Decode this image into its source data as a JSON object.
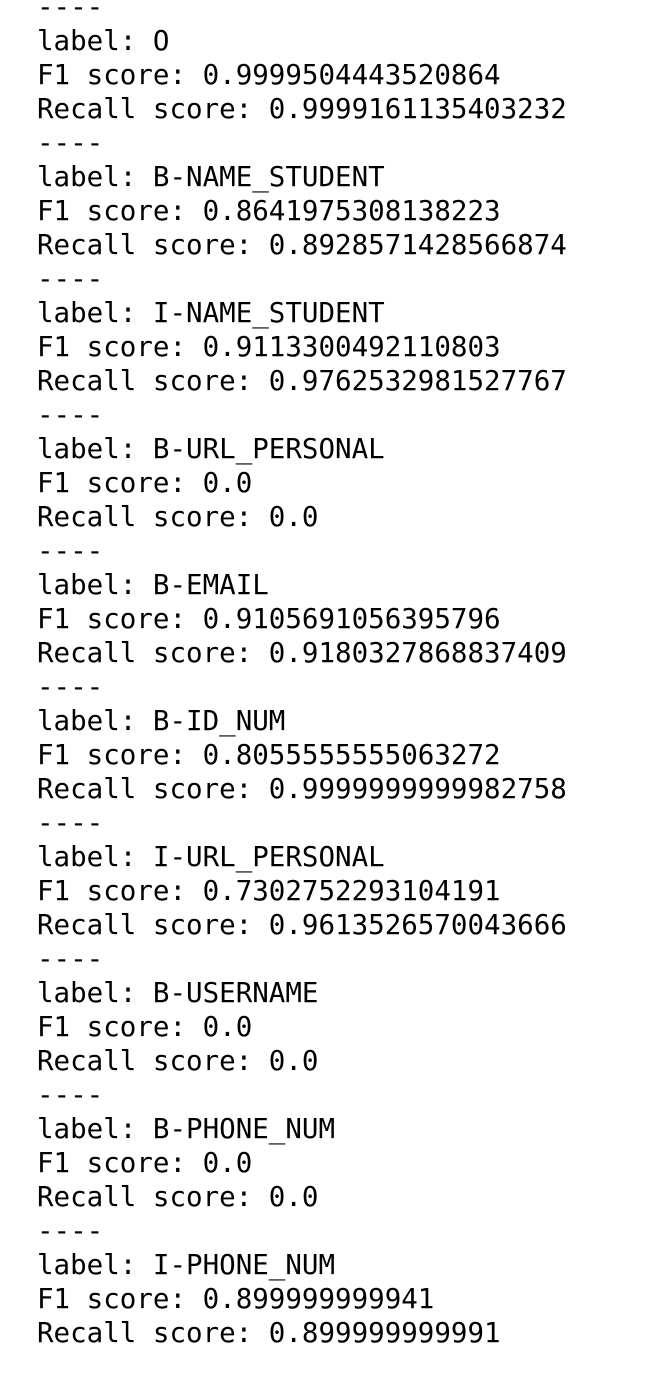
{
  "separator": "----",
  "label_prefix": "label: ",
  "f1_prefix": "F1 score: ",
  "recall_prefix": "Recall score: ",
  "entries": [
    {
      "label": "O",
      "f1": "0.9999504443520864",
      "recall": "0.9999161135403232"
    },
    {
      "label": "B-NAME_STUDENT",
      "f1": "0.8641975308138223",
      "recall": "0.8928571428566874"
    },
    {
      "label": "I-NAME_STUDENT",
      "f1": "0.9113300492110803",
      "recall": "0.9762532981527767"
    },
    {
      "label": "B-URL_PERSONAL",
      "f1": "0.0",
      "recall": "0.0"
    },
    {
      "label": "B-EMAIL",
      "f1": "0.9105691056395796",
      "recall": "0.9180327868837409"
    },
    {
      "label": "B-ID_NUM",
      "f1": "0.8055555555063272",
      "recall": "0.9999999999982758"
    },
    {
      "label": "I-URL_PERSONAL",
      "f1": "0.7302752293104191",
      "recall": "0.9613526570043666"
    },
    {
      "label": "B-USERNAME",
      "f1": "0.0",
      "recall": "0.0"
    },
    {
      "label": "B-PHONE_NUM",
      "f1": "0.0",
      "recall": "0.0"
    },
    {
      "label": "I-PHONE_NUM",
      "f1": "0.899999999941",
      "recall": "0.899999999991"
    }
  ]
}
